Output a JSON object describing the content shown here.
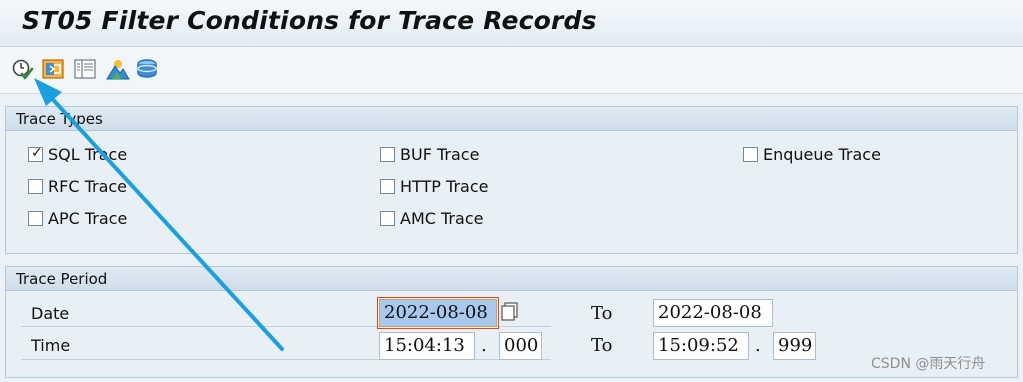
{
  "window": {
    "title": "ST05 Filter Conditions for Trace Records"
  },
  "toolbar": {
    "buttons": [
      {
        "icon": "execute-icon",
        "color": "#2e8b3a"
      },
      {
        "icon": "load-variant-icon",
        "color": "#e28a17"
      },
      {
        "icon": "columns-icon",
        "color": "#6c7a86"
      },
      {
        "icon": "mountain-image-icon",
        "color": "#2f8fd6"
      },
      {
        "icon": "database-icon",
        "color": "#2f8fd6"
      }
    ]
  },
  "trace_types": {
    "title": "Trace Types",
    "items": [
      {
        "label": "SQL Trace",
        "checked": true
      },
      {
        "label": "BUF Trace",
        "checked": false
      },
      {
        "label": "Enqueue Trace",
        "checked": false
      },
      {
        "label": "RFC Trace",
        "checked": false
      },
      {
        "label": "HTTP Trace",
        "checked": false
      },
      {
        "label": "APC Trace",
        "checked": false
      },
      {
        "label": "AMC Trace",
        "checked": false
      }
    ]
  },
  "trace_period": {
    "title": "Trace Period",
    "date": {
      "label": "Date",
      "from": "2022-08-08",
      "to_label": "To",
      "to": "2022-08-08"
    },
    "time": {
      "label": "Time",
      "from": "15:04:13",
      "from_ms": "000",
      "to_label": "To",
      "to": "15:09:52",
      "to_ms": "999",
      "separator": "."
    }
  },
  "annotation": {
    "arrow_color": "#1aa0e0"
  },
  "watermark": "CSDN @雨天行舟"
}
